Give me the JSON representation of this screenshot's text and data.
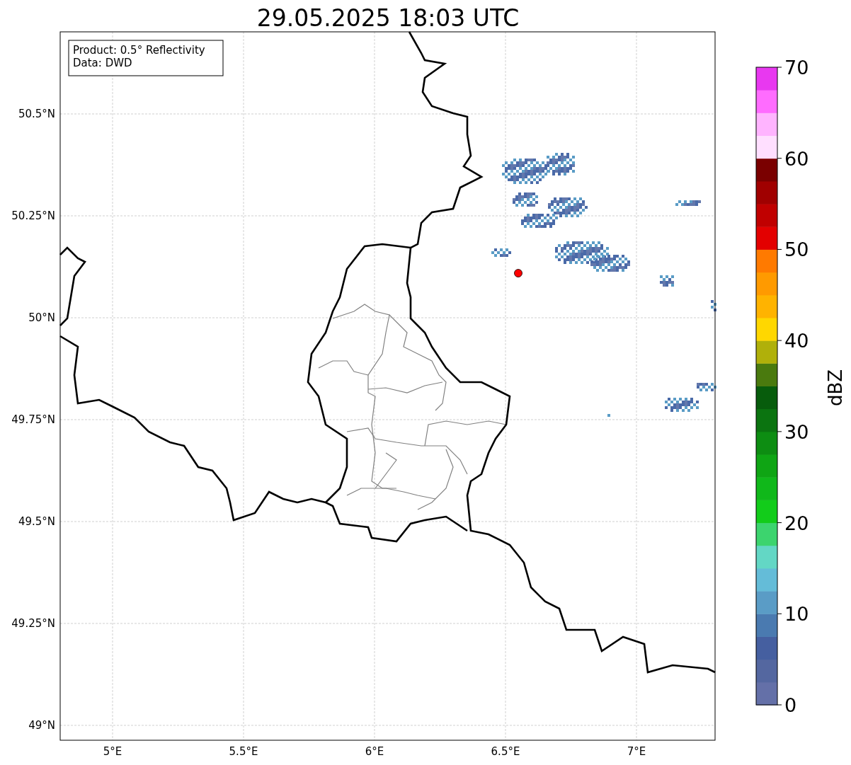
{
  "title": "29.05.2025 18:03 UTC",
  "info_box": {
    "lines": [
      "Product: 0.5° Reflectivity",
      "Data: DWD"
    ]
  },
  "map": {
    "lat_ticks": [
      "50.5°N",
      "50.25°N",
      "50°N",
      "49.75°N",
      "49.5°N",
      "49.25°N",
      "49°N"
    ],
    "lon_ticks": [
      "5°E",
      "5.5°E",
      "6°E",
      "6.5°E",
      "7°E"
    ]
  },
  "colorbar": {
    "label": "dBZ",
    "ticks": [
      "70",
      "60",
      "50",
      "40",
      "30",
      "20",
      "10",
      "0"
    ],
    "segments": [
      {
        "color": "#6470a8"
      },
      {
        "color": "#5467a0"
      },
      {
        "color": "#455fa0"
      },
      {
        "color": "#4a7ab0"
      },
      {
        "color": "#5a9cc6"
      },
      {
        "color": "#64bcd8"
      },
      {
        "color": "#63d7c5"
      },
      {
        "color": "#3cd46e"
      },
      {
        "color": "#12cc1a"
      },
      {
        "color": "#10b81a"
      },
      {
        "color": "#0fa514"
      },
      {
        "color": "#0d8d12"
      },
      {
        "color": "#0b7410"
      },
      {
        "color": "#075c0c"
      },
      {
        "color": "#4a7a0e"
      },
      {
        "color": "#b0b00a"
      },
      {
        "color": "#ffd700"
      },
      {
        "color": "#ffb300"
      },
      {
        "color": "#ff9a00"
      },
      {
        "color": "#ff7a00"
      },
      {
        "color": "#e30000"
      },
      {
        "color": "#c00000"
      },
      {
        "color": "#a00000"
      },
      {
        "color": "#7a0000"
      },
      {
        "color": "#ffdfff"
      },
      {
        "color": "#ffb4ff"
      },
      {
        "color": "#ff6cff"
      },
      {
        "color": "#e838f0"
      }
    ]
  }
}
